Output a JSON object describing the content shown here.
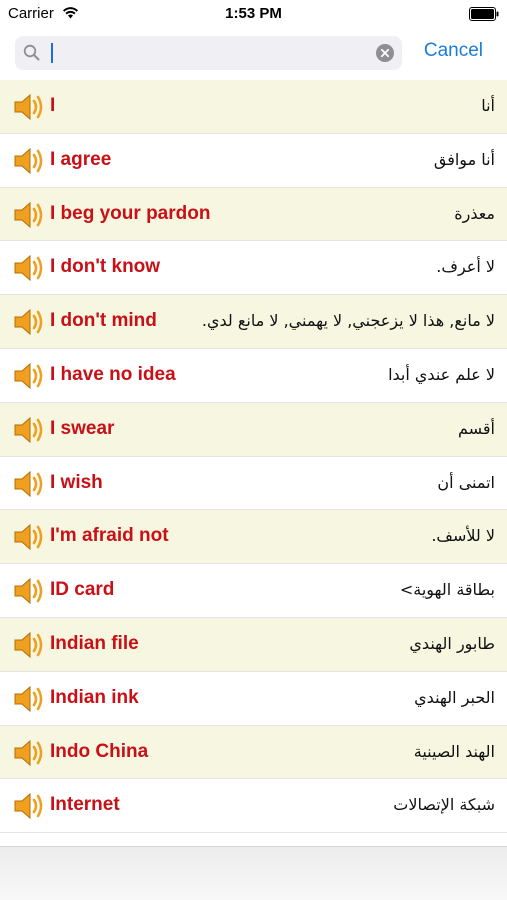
{
  "status": {
    "carrier": "Carrier",
    "time": "1:53 PM"
  },
  "search": {
    "value": "",
    "placeholder": "",
    "cancel_label": "Cancel"
  },
  "rows": [
    {
      "en": "I",
      "ar": "أنا"
    },
    {
      "en": "I agree",
      "ar": "أنا موافق"
    },
    {
      "en": "I beg your pardon",
      "ar": "معذرة"
    },
    {
      "en": "I don't know",
      "ar": "لا أعرف."
    },
    {
      "en": "I don't mind",
      "ar": "لا مانع, هذا لا يزعجني, لا يهمني, لا مانع لدي."
    },
    {
      "en": "I have no idea",
      "ar": "لا علم عندي أبدا"
    },
    {
      "en": "I swear",
      "ar": "أقسم"
    },
    {
      "en": "I wish",
      "ar": "اتمنى أن"
    },
    {
      "en": "I'm afraid not",
      "ar": "لا للأسف."
    },
    {
      "en": "ID card",
      "ar": "بطاقة الهوية>"
    },
    {
      "en": "Indian file",
      "ar": "طابور الهندي"
    },
    {
      "en": "Indian ink",
      "ar": "الحبر الهندي"
    },
    {
      "en": "Indo China",
      "ar": "الهند الصينية"
    },
    {
      "en": "Internet",
      "ar": "شبكة الإتصالات"
    }
  ],
  "icons": {
    "row_icon": "speaker-icon",
    "search": "search-icon",
    "clear": "clear-icon"
  },
  "colors": {
    "odd_row": "#f6f6e1",
    "term": "#c81016",
    "accent": "#1a7ddb",
    "speaker": "#f0a020"
  }
}
